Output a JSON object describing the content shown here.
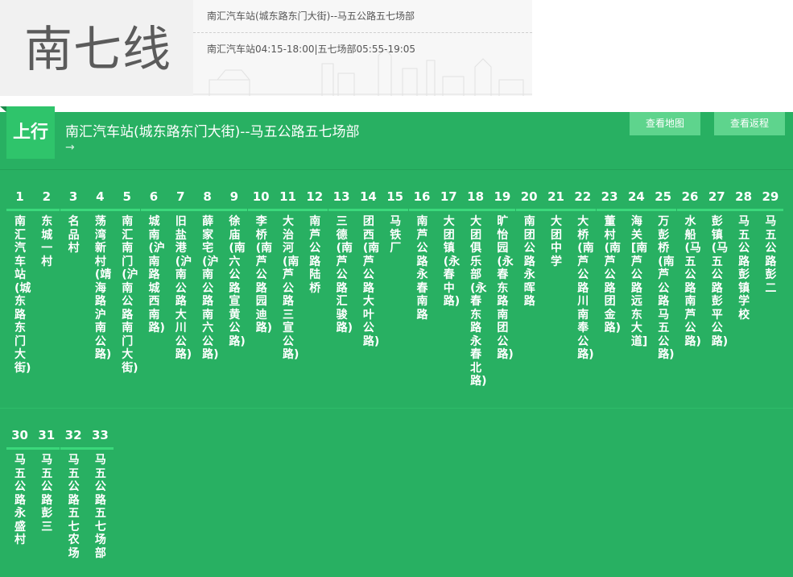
{
  "line": {
    "name": "南七线",
    "route": "南汇汽车站(城东路东门大街)--马五公路五七场部",
    "hours": "南汇汽车站04:15-18:00|五七场部05:55-19:05"
  },
  "panel": {
    "direction_label": "上行",
    "route_title": "南汇汽车站(城东路东门大街)--马五公路五七场部",
    "arrow": "→",
    "map_button": "查看地图",
    "return_button": "查看返程"
  },
  "colors": {
    "panel": "#28b062",
    "tag": "#2fc46b",
    "button": "#5ed48d",
    "bar": "#3bd87b"
  },
  "stops": [
    {
      "num": "1",
      "name": "南汇汽车站(城东路东门大街)"
    },
    {
      "num": "2",
      "name": "东城一村"
    },
    {
      "num": "3",
      "name": "名品村"
    },
    {
      "num": "4",
      "name": "荡湾新村(靖海路沪南公路)"
    },
    {
      "num": "5",
      "name": "南汇南门(沪南公路南门大街)"
    },
    {
      "num": "6",
      "name": "城南(沪南路城西南路)"
    },
    {
      "num": "7",
      "name": "旧盐港(沪南公路大川公路)"
    },
    {
      "num": "8",
      "name": "薛家宅(沪南公路南六公路)"
    },
    {
      "num": "9",
      "name": "徐庙(南六公路宣黄公路)"
    },
    {
      "num": "10",
      "name": "李桥(南芦公路园迪路)"
    },
    {
      "num": "11",
      "name": "大治河(南芦公路三宣公路)"
    },
    {
      "num": "12",
      "name": "南芦公路陆桥"
    },
    {
      "num": "13",
      "name": "三德(南芦公路汇骏路)"
    },
    {
      "num": "14",
      "name": "团西(南芦公路大叶公路)"
    },
    {
      "num": "15",
      "name": "马铁厂"
    },
    {
      "num": "16",
      "name": "南芦公路永春南路"
    },
    {
      "num": "17",
      "name": "大团镇(永春中路)"
    },
    {
      "num": "18",
      "name": "大团俱乐部(永春东路永春北路)"
    },
    {
      "num": "19",
      "name": "旷怡园(永春东路南团公路)"
    },
    {
      "num": "20",
      "name": "南团公路永晖路"
    },
    {
      "num": "21",
      "name": "大团中学"
    },
    {
      "num": "22",
      "name": "大桥(南芦公路川南奉公路)"
    },
    {
      "num": "23",
      "name": "董村(南芦公路团金路)"
    },
    {
      "num": "24",
      "name": "海关[南芦公路远东大道]"
    },
    {
      "num": "25",
      "name": "万彭桥(南芦公路马五公路)"
    },
    {
      "num": "26",
      "name": "水船(马五公路南芦公路)"
    },
    {
      "num": "27",
      "name": "彭镇(马五公路彭平公路)"
    },
    {
      "num": "28",
      "name": "马五公路彭镇学校"
    },
    {
      "num": "29",
      "name": "马五公路彭二"
    },
    {
      "num": "30",
      "name": "马五公路永盛村"
    },
    {
      "num": "31",
      "name": "马五公路彭三"
    },
    {
      "num": "32",
      "name": "马五公路五七农场"
    },
    {
      "num": "33",
      "name": "马五公路五七场部"
    }
  ]
}
